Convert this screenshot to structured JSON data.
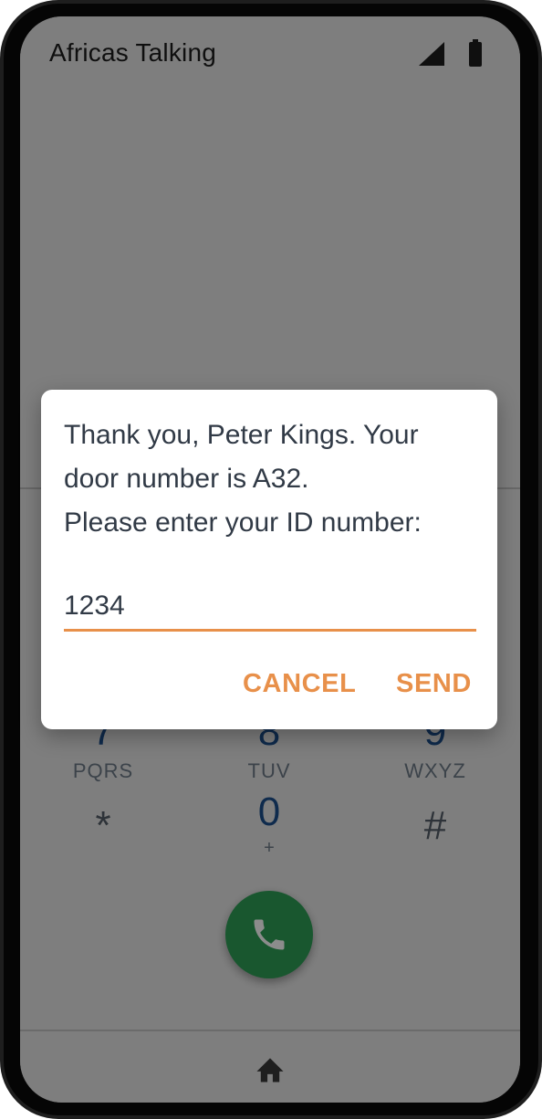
{
  "status_bar": {
    "carrier": "Africas Talking",
    "icons": [
      "signal-icon",
      "battery-icon"
    ]
  },
  "dialpad": {
    "keys": [
      {
        "digit": "7",
        "letters": "PQRS"
      },
      {
        "digit": "8",
        "letters": "TUV"
      },
      {
        "digit": "9",
        "letters": "WXYZ"
      },
      {
        "digit": "*",
        "letters": ""
      },
      {
        "digit": "0",
        "letters": "+"
      },
      {
        "digit": "#",
        "letters": ""
      }
    ],
    "call_icon": "phone-icon"
  },
  "bottom_nav": {
    "icon": "home-icon"
  },
  "dialog": {
    "message": "Thank you, Peter Kings. Your\ndoor number is A32.\nPlease enter your ID number:",
    "input_value": "1234",
    "cancel_label": "CANCEL",
    "send_label": "SEND"
  },
  "colors": {
    "accent": "#e8904a",
    "call_green": "#2e9e57",
    "digit_blue": "#1c4f8c",
    "dialog_text": "#313a46"
  }
}
